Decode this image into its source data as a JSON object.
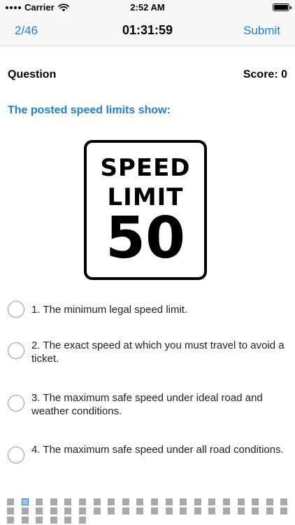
{
  "status_bar": {
    "carrier": "Carrier",
    "time": "2:52 AM"
  },
  "nav": {
    "progress": "2/46",
    "timer": "01:31:59",
    "submit_label": "Submit"
  },
  "question": {
    "label": "Question",
    "score": "Score: 0",
    "text": "The posted speed limits show:",
    "sign": {
      "line1": "SPEED",
      "line2": "LIMIT",
      "number": "50"
    }
  },
  "options": [
    {
      "label": "1. The minimum legal speed limit."
    },
    {
      "label": "2. The exact speed at which you must travel to avoid a ticket."
    },
    {
      "label": "3. The maximum safe speed under ideal road and weather conditions."
    },
    {
      "label": "4. The maximum safe speed under all road conditions."
    }
  ],
  "question_grid": {
    "total": 46,
    "current": 2
  },
  "colors": {
    "accent": "#1e7fdc",
    "grid_cell": "#a9a9a9",
    "grid_current": "#9ec3e6"
  }
}
